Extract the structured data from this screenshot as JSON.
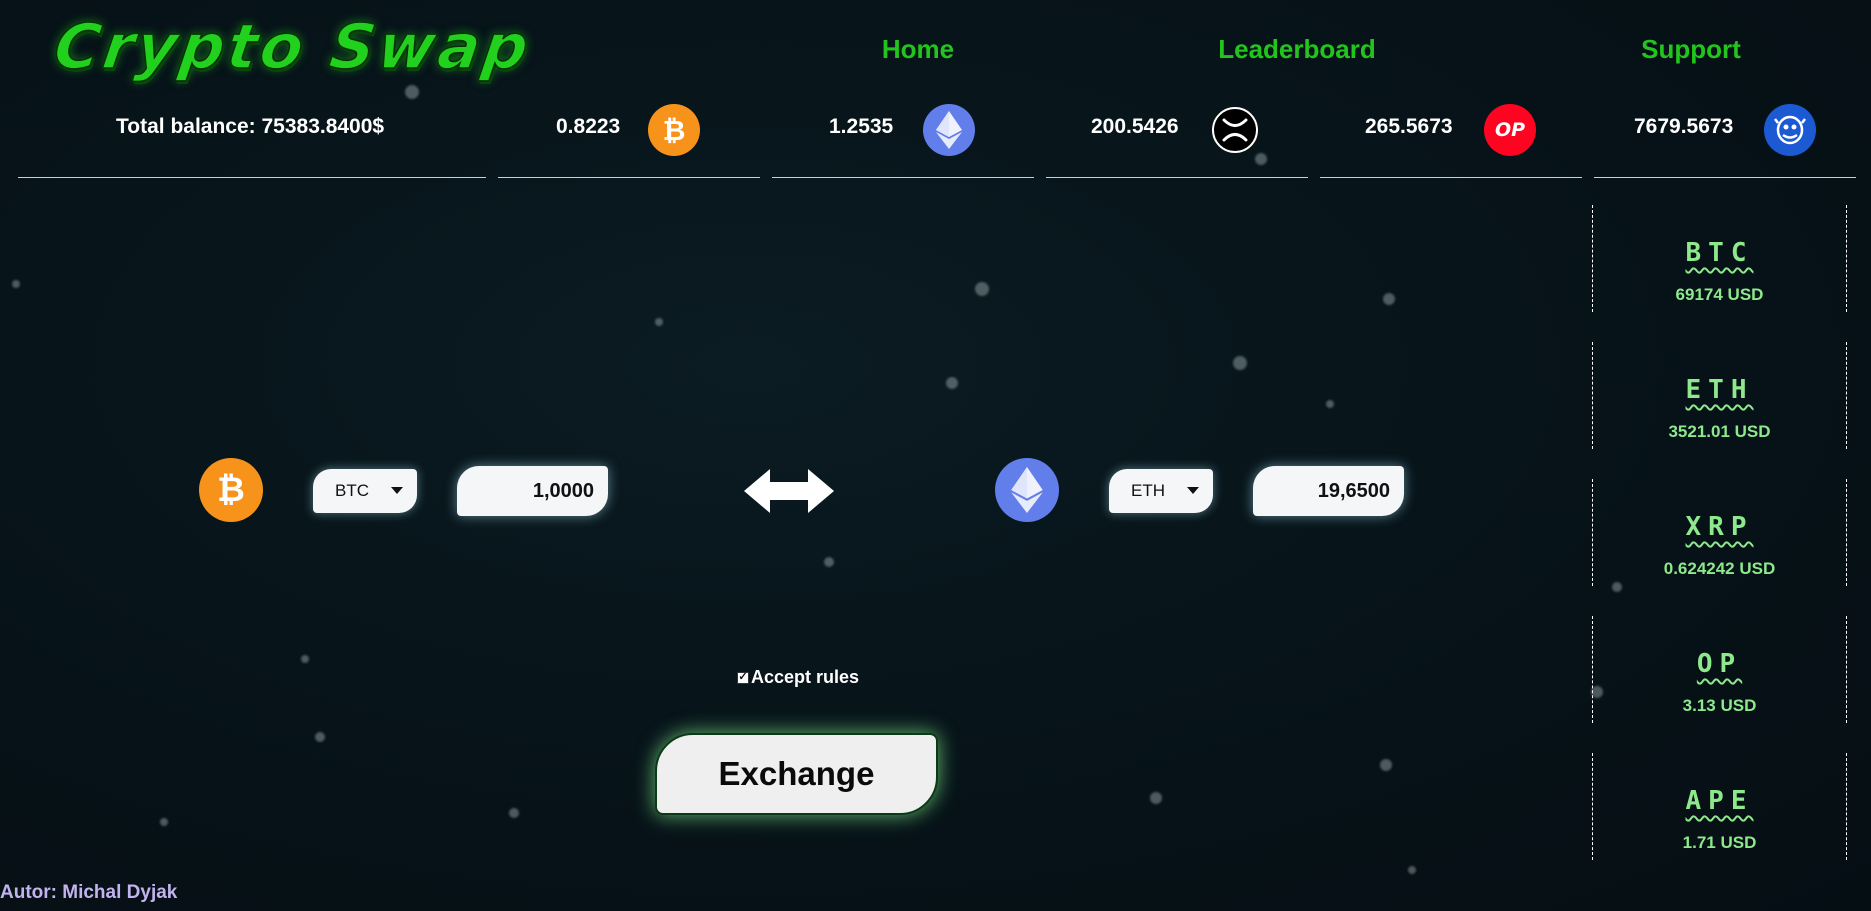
{
  "app": {
    "logo_text": "Crypto Swap"
  },
  "nav": {
    "home": "Home",
    "leaderboard": "Leaderboard",
    "support": "Support"
  },
  "balances": {
    "total_label": "Total balance: 75383.8400$",
    "btc": "0.8223",
    "eth": "1.2535",
    "xrp": "200.5426",
    "op": "265.5673",
    "ape": "7679.5673"
  },
  "icons": {
    "btc": "bitcoin-coin-icon",
    "eth": "ethereum-coin-icon",
    "xrp": "xrp-coin-icon",
    "op": "optimism-coin-icon",
    "ape": "apecoin-coin-icon",
    "op_glyph": "OP",
    "btc_glyph": "₿"
  },
  "swap": {
    "from_currency": "BTC",
    "from_amount": "1,0000",
    "to_currency": "ETH",
    "to_amount": "19,6500",
    "accept_label": "Accept rules",
    "accept_checked": true,
    "exchange_label": "Exchange"
  },
  "prices": [
    {
      "symbol": "BTC",
      "value": "69174 USD"
    },
    {
      "symbol": "ETH",
      "value": "3521.01 USD"
    },
    {
      "symbol": "XRP",
      "value": "0.624242 USD"
    },
    {
      "symbol": "OP",
      "value": "3.13 USD"
    },
    {
      "symbol": "APE",
      "value": "1.71 USD"
    }
  ],
  "footer": {
    "author": "Autor: Michal Dyjak"
  },
  "colors": {
    "accent_green": "#22c51c",
    "price_green": "#8ee88c",
    "btc_orange": "#f7931a",
    "eth_blue": "#627eea",
    "op_red": "#ff0420",
    "ape_blue": "#1c5ad4",
    "author_lavender": "#c2b3ee",
    "background": "#07141a"
  }
}
